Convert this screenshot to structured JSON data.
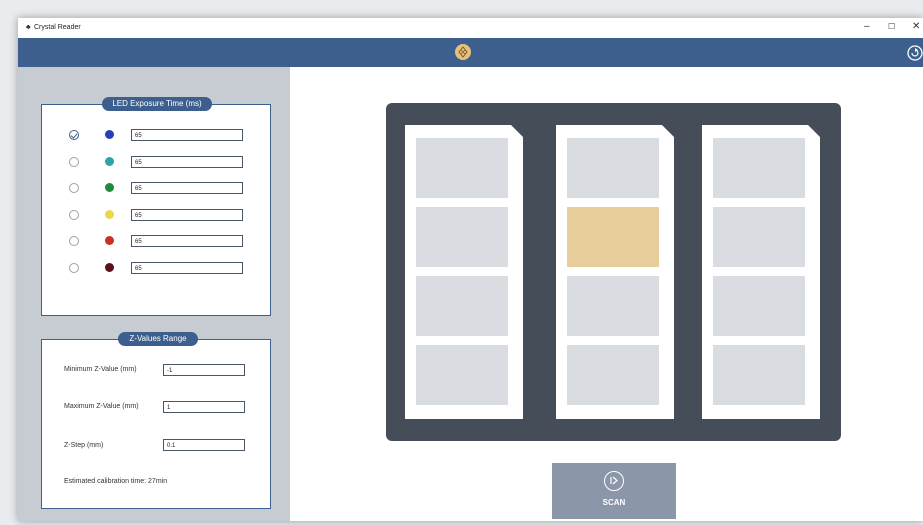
{
  "window": {
    "title": "Crystal Reader",
    "controls": {
      "minimize": "–",
      "maximize": "☐",
      "close": "✕"
    }
  },
  "led_panel": {
    "title": "LED Exposure Time (ms)",
    "rows": [
      {
        "color": "#2a3fb3",
        "value": "65",
        "checked": true
      },
      {
        "color": "#2aa6a6",
        "value": "65",
        "checked": false
      },
      {
        "color": "#1f8a3a",
        "value": "65",
        "checked": false
      },
      {
        "color": "#e9d84a",
        "value": "65",
        "checked": false
      },
      {
        "color": "#c8302a",
        "value": "65",
        "checked": false
      },
      {
        "color": "#5a0f1a",
        "value": "65",
        "checked": false
      }
    ]
  },
  "z_panel": {
    "title": "Z-Values Range",
    "min_label": "Minimum Z-Value (mm)",
    "min_value": "-1",
    "max_label": "Maximum Z-Value (mm)",
    "max_value": "1",
    "step_label": "Z-Step (mm)",
    "step_value": "0.1",
    "estimate": "Estimated calibration time: 27min"
  },
  "tray": {
    "plates": [
      {
        "selected_well": -1
      },
      {
        "selected_well": 1
      },
      {
        "selected_well": -1
      }
    ]
  },
  "scan": {
    "label": "SCAN"
  },
  "colors": {
    "accent": "#3c5f8d",
    "selected_well": "#e7ce9b",
    "tray": "#454d59"
  }
}
